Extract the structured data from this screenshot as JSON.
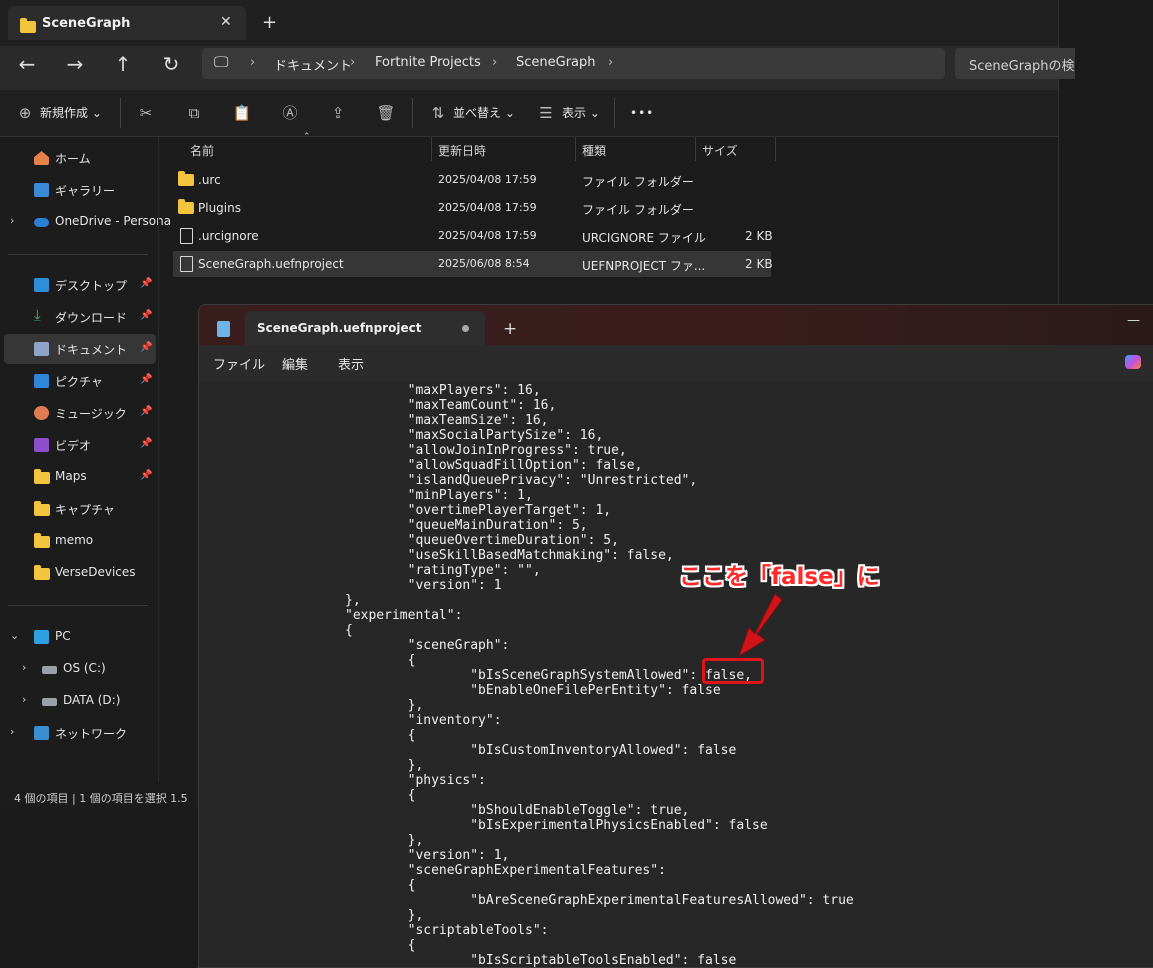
{
  "explorer": {
    "tab_title": "SceneGraph",
    "new_tab_symbol": "+",
    "close_symbol": "✕",
    "breadcrumb": [
      "ドキュメント",
      "Fortnite Projects",
      "SceneGraph"
    ],
    "search_placeholder": "SceneGraphの検",
    "toolbar": {
      "new_label": "新規作成",
      "sort_label": "並べ替え",
      "view_label": "表示",
      "more_label": "•••"
    },
    "sidebar": {
      "home": "ホーム",
      "gallery": "ギャラリー",
      "onedrive": "OneDrive - Persona",
      "pinned": [
        "デスクトップ",
        "ダウンロード",
        "ドキュメント",
        "ピクチャ",
        "ミュージック",
        "ビデオ",
        "Maps"
      ],
      "folders": [
        "キャプチャ",
        "memo",
        "VerseDevices"
      ],
      "pc": "PC",
      "drives": [
        "OS (C:)",
        "DATA (D:)"
      ],
      "network": "ネットワーク"
    },
    "columns": [
      "名前",
      "更新日時",
      "種類",
      "サイズ"
    ],
    "files": [
      {
        "name": ".urc",
        "date": "2025/04/08 17:59",
        "type": "ファイル フォルダー",
        "size": ""
      },
      {
        "name": "Plugins",
        "date": "2025/04/08 17:59",
        "type": "ファイル フォルダー",
        "size": ""
      },
      {
        "name": ".urcignore",
        "date": "2025/04/08 17:59",
        "type": "URCIGNORE ファイル",
        "size": "2 KB"
      },
      {
        "name": "SceneGraph.uefnproject",
        "date": "2025/06/08 8:54",
        "type": "UEFNPROJECT ファ...",
        "size": "2 KB"
      }
    ],
    "status": "4 個の項目  |  1 個の項目を選択  1.5"
  },
  "notepad": {
    "tab_title": "SceneGraph.uefnproject",
    "new_tab_symbol": "+",
    "minimize_symbol": "—",
    "menu": [
      "ファイル",
      "編集",
      "表示"
    ],
    "lines": [
      "        \"maxPlayers\": 16,",
      "        \"maxTeamCount\": 16,",
      "        \"maxTeamSize\": 16,",
      "        \"maxSocialPartySize\": 16,",
      "        \"allowJoinInProgress\": true,",
      "        \"allowSquadFillOption\": false,",
      "        \"islandQueuePrivacy\": \"Unrestricted\",",
      "        \"minPlayers\": 1,",
      "        \"overtimePlayerTarget\": 1,",
      "        \"queueMainDuration\": 5,",
      "        \"queueOvertimeDuration\": 5,",
      "        \"useSkillBasedMatchmaking\": false,",
      "        \"ratingType\": \"\",",
      "        \"version\": 1",
      "},",
      "\"experimental\":",
      "{",
      "        \"sceneGraph\":",
      "        {",
      "                \"bIsSceneGraphSystemAllowed\": false,",
      "                \"bEnableOneFilePerEntity\": false",
      "        },",
      "        \"inventory\":",
      "        {",
      "                \"bIsCustomInventoryAllowed\": false",
      "        },",
      "        \"physics\":",
      "        {",
      "                \"bShouldEnableToggle\": true,",
      "                \"bIsExperimentalPhysicsEnabled\": false",
      "        },",
      "        \"version\": 1,",
      "        \"sceneGraphExperimentalFeatures\":",
      "        {",
      "                \"bAreSceneGraphExperimentalFeaturesAllowed\": true",
      "        },",
      "        \"scriptableTools\":",
      "        {",
      "                \"bIsScriptableToolsEnabled\": false"
    ]
  },
  "annotation": {
    "text": "ここを「false」に",
    "color": "#ff2a2a"
  }
}
